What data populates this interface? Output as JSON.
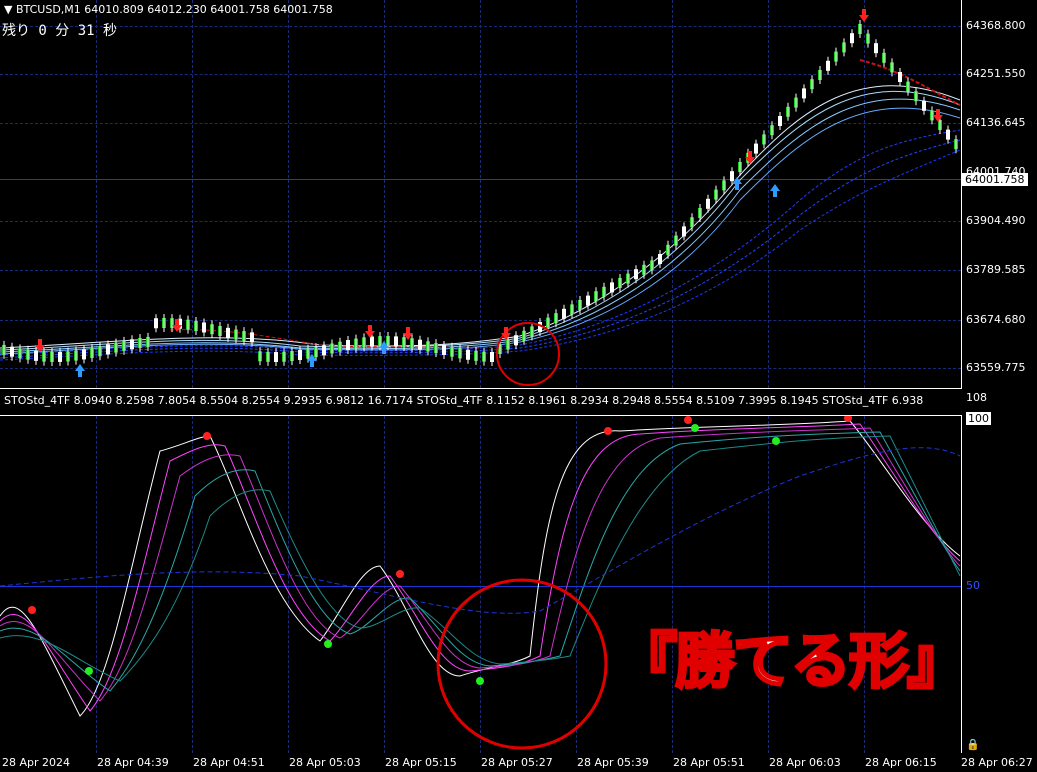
{
  "symbol_info": "BTCUSD,M1  64010.809 64012.230 64001.758 64001.758",
  "timer_text": "残り 0 分 31 秒",
  "indicator_info": "STOStd_4TF 8.0940 8.2598 7.8054 8.5504 8.2554 9.2935 6.9812 16.7174  STOStd_4TF 8.1152 8.1961 8.2934 8.2948 8.5554 8.5109 7.3995 8.1945  STOStd_4TF 6.938",
  "price_axis": [
    "64368.800",
    "64251.550",
    "64136.645",
    "64001.740",
    "63904.490",
    "63789.585",
    "63674.680",
    "63559.775"
  ],
  "current_price": "64001.758",
  "indicator_axis": {
    "top": "108",
    "max": "100",
    "mid": "50"
  },
  "time_axis": [
    "28 Apr 2024",
    "28 Apr 04:39",
    "28 Apr 04:51",
    "28 Apr 05:03",
    "28 Apr 05:15",
    "28 Apr 05:27",
    "28 Apr 05:39",
    "28 Apr 05:51",
    "28 Apr 06:03",
    "28 Apr 06:15",
    "28 Apr 06:27"
  ],
  "overlay_caption": "『勝てる形』",
  "colors": {
    "bull": "#22cc22",
    "bear": "#ffffff",
    "grid": "#1a2a7a",
    "accent": "#e10000",
    "line_blue": "#1c35d6"
  }
}
